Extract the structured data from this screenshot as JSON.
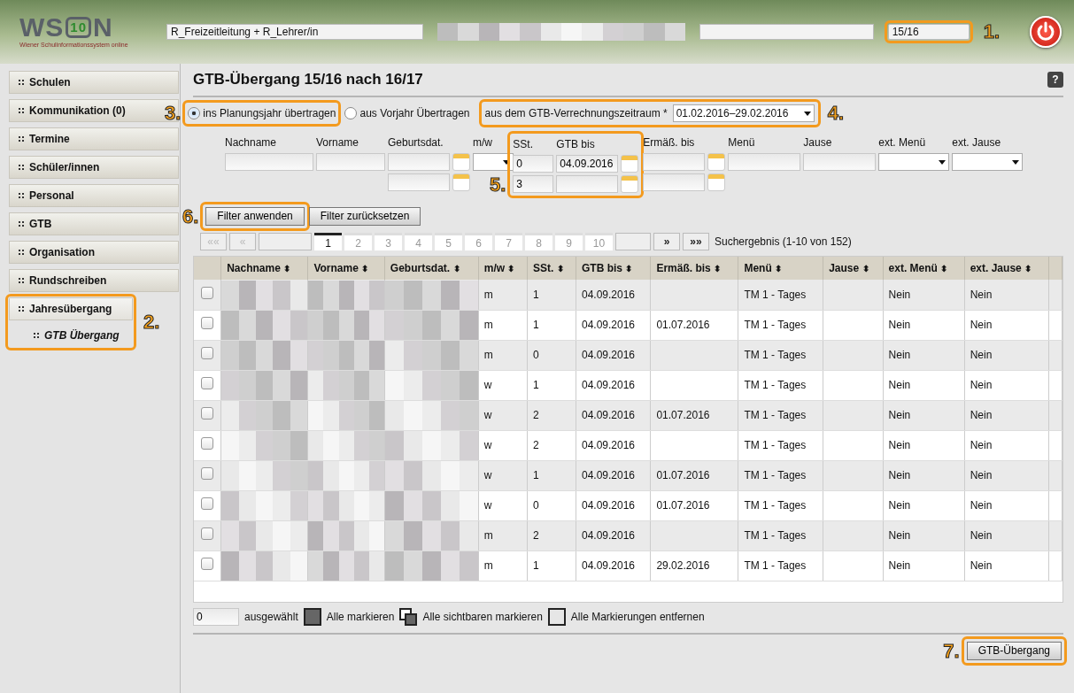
{
  "header": {
    "logo": {
      "left": "WS",
      "badge": "10",
      "right": "N",
      "subtitle": "Wiener Schulinformationssystem online"
    },
    "role": "R_Freizeitleitung + R_Lehrer/in",
    "year": "15/16",
    "callout": "1."
  },
  "sidebar": {
    "items": [
      {
        "label": "Schulen",
        "selected": false
      },
      {
        "label": "Kommunikation (0)",
        "selected": false
      },
      {
        "label": "Termine",
        "selected": false
      },
      {
        "label": "Schüler/innen",
        "selected": false
      },
      {
        "label": "Personal",
        "selected": false
      },
      {
        "label": "GTB",
        "selected": false
      },
      {
        "label": "Organisation",
        "selected": false
      },
      {
        "label": "Rundschreiben",
        "selected": false
      },
      {
        "label": "Jahresübergang",
        "selected": true,
        "highlighted": true,
        "children": [
          {
            "label": "GTB Übergang",
            "selected": true
          }
        ]
      }
    ],
    "callout": "2."
  },
  "page": {
    "title": "GTB-Übergang 15/16 nach 16/17",
    "help": "?"
  },
  "mode": {
    "options": [
      {
        "label": "ins Planungsjahr übertragen",
        "selected": true
      },
      {
        "label": "aus Vorjahr Übertragen",
        "selected": false
      }
    ],
    "callout": "3."
  },
  "period": {
    "label": "aus dem GTB-Verrechnungszeitraum *",
    "value": "01.02.2016–29.02.2016",
    "callout": "4."
  },
  "filters": {
    "columns": [
      {
        "label": "Nachname",
        "kind": "text",
        "rows": [
          ""
        ]
      },
      {
        "label": "Vorname",
        "kind": "text",
        "rows": [
          ""
        ]
      },
      {
        "label": "Geburtsdat.",
        "kind": "date",
        "rows": [
          "",
          ""
        ]
      },
      {
        "label": "m/w",
        "kind": "select",
        "rows": [
          ""
        ]
      },
      {
        "label": "SSt.",
        "kind": "short",
        "rows": [
          "0",
          "3"
        ],
        "highlighted": true
      },
      {
        "label": "GTB bis",
        "kind": "date",
        "rows": [
          "04.09.2016",
          ""
        ],
        "highlighted": true
      },
      {
        "label": "Ermäß. bis",
        "kind": "date",
        "rows": [
          "",
          ""
        ]
      },
      {
        "label": "Menü",
        "kind": "text",
        "rows": [
          ""
        ]
      },
      {
        "label": "Jause",
        "kind": "text",
        "rows": [
          ""
        ]
      },
      {
        "label": "ext. Menü",
        "kind": "select",
        "rows": [
          ""
        ]
      },
      {
        "label": "ext. Jause",
        "kind": "select",
        "rows": [
          ""
        ]
      }
    ],
    "callout": "5."
  },
  "filter_buttons": {
    "apply": "Filter anwenden",
    "reset": "Filter zurücksetzen",
    "callout": "6."
  },
  "pagination": {
    "first": "««",
    "prev": "«",
    "pages": [
      {
        "label": "1",
        "selected": true
      },
      {
        "label": "2",
        "selected": false
      },
      {
        "label": "3",
        "selected": false
      },
      {
        "label": "4",
        "selected": false
      },
      {
        "label": "5",
        "selected": false
      },
      {
        "label": "6",
        "selected": false
      },
      {
        "label": "7",
        "selected": false
      },
      {
        "label": "8",
        "selected": false
      },
      {
        "label": "9",
        "selected": false
      },
      {
        "label": "10",
        "selected": false
      }
    ],
    "next": "»",
    "last": "»»",
    "result": "Suchergebnis (1-10 von 152)"
  },
  "table": {
    "columns": [
      "Nachname",
      "Vorname",
      "Geburtsdat.",
      "m/w",
      "SSt.",
      "GTB bis",
      "Ermäß. bis",
      "Menü",
      "Jause",
      "ext. Menü",
      "ext. Jause"
    ],
    "sort_icon": "⬍",
    "rows": [
      {
        "checked": false,
        "cells": [
          "",
          "",
          "",
          "m",
          "1",
          "04.09.2016",
          "",
          "TM 1 - Tages",
          "",
          "Nein",
          "Nein"
        ]
      },
      {
        "checked": false,
        "cells": [
          "",
          "",
          "",
          "m",
          "1",
          "04.09.2016",
          "01.07.2016",
          "TM 1 - Tages",
          "",
          "Nein",
          "Nein"
        ]
      },
      {
        "checked": false,
        "cells": [
          "",
          "",
          "",
          "m",
          "0",
          "04.09.2016",
          "",
          "TM 1 - Tages",
          "",
          "Nein",
          "Nein"
        ]
      },
      {
        "checked": false,
        "cells": [
          "",
          "",
          "",
          "w",
          "1",
          "04.09.2016",
          "",
          "TM 1 - Tages",
          "",
          "Nein",
          "Nein"
        ]
      },
      {
        "checked": false,
        "cells": [
          "",
          "",
          "",
          "w",
          "2",
          "04.09.2016",
          "01.07.2016",
          "TM 1 - Tages",
          "",
          "Nein",
          "Nein"
        ]
      },
      {
        "checked": false,
        "cells": [
          "",
          "",
          "",
          "w",
          "2",
          "04.09.2016",
          "",
          "TM 1 - Tages",
          "",
          "Nein",
          "Nein"
        ]
      },
      {
        "checked": false,
        "cells": [
          "",
          "",
          "",
          "w",
          "1",
          "04.09.2016",
          "01.07.2016",
          "TM 1 - Tages",
          "",
          "Nein",
          "Nein"
        ]
      },
      {
        "checked": false,
        "cells": [
          "",
          "",
          "",
          "w",
          "0",
          "04.09.2016",
          "01.07.2016",
          "TM 1 - Tages",
          "",
          "Nein",
          "Nein"
        ]
      },
      {
        "checked": false,
        "cells": [
          "",
          "",
          "",
          "m",
          "2",
          "04.09.2016",
          "",
          "TM 1 - Tages",
          "",
          "Nein",
          "Nein"
        ]
      },
      {
        "checked": false,
        "cells": [
          "",
          "",
          "",
          "m",
          "1",
          "04.09.2016",
          "29.02.2016",
          "TM 1 - Tages",
          "",
          "Nein",
          "Nein"
        ]
      }
    ]
  },
  "selection": {
    "count": "0",
    "count_label": "ausgewählt",
    "actions": [
      {
        "kind": "all",
        "label": "Alle markieren"
      },
      {
        "kind": "visible",
        "label": "Alle sichtbaren markieren"
      },
      {
        "kind": "none",
        "label": "Alle Markierungen entfernen"
      }
    ]
  },
  "submit": {
    "label": "GTB-Übergang",
    "callout": "7."
  }
}
